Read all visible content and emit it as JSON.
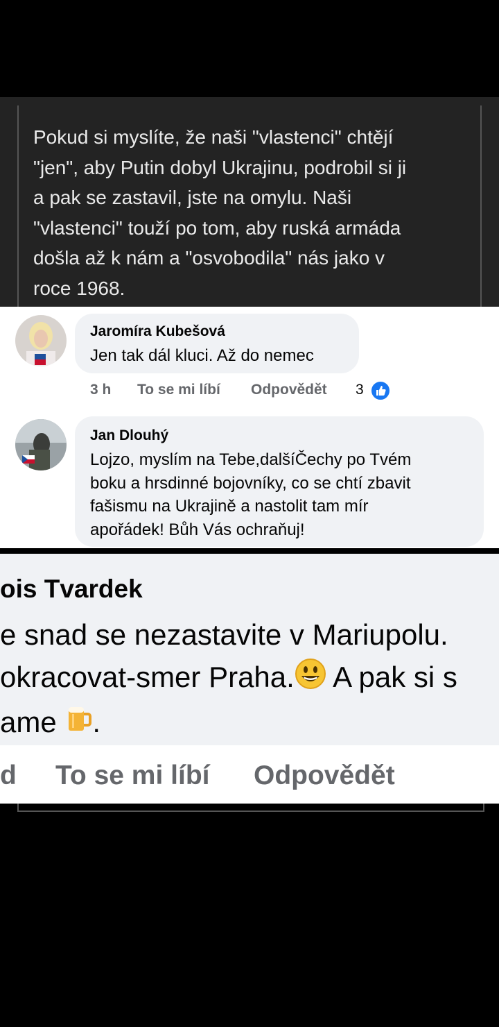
{
  "post": {
    "text": "Pokud si myslíte, že naši \"vlastenci\" chtějí\n\"jen\", aby Putin dobyl Ukrajinu, podrobil si ji\na pak se zastavil, jste na omylu. Naši\n\"vlastenci\" touží po tom, aby ruská armáda\ndošla až k nám a \"osvobodila\" nás jako v\nroce 1968."
  },
  "comments": [
    {
      "author": "Jaromíra Kubešová",
      "text": "Jen tak dál kluci. Až do nemec",
      "time": "3 h",
      "like_label": "To se mi líbí",
      "reply_label": "Odpovědět",
      "reactions": "3",
      "reaction_icon": "thumbs-up-icon"
    },
    {
      "author": "Jan Dlouhý",
      "text": "Lojzo, myslím na Tebe,dalšíČechy po Tvém\nboku a hrsdinné bojovníky, co se chtí zbavit\nfašismu na Ukrajině a nastolit tam mír\napořádek! Bůh Vás ochraňuj!"
    }
  ],
  "zoomed_comment": {
    "author": "ois Tvardek",
    "line1": "e snad se nezastavite v Mariupolu.",
    "line2": "okracovat-smer Praha.",
    "line2b": " A pak si s",
    "line3": "ame ",
    "line3b": ".",
    "time_fragment": "d",
    "like_label": "To se mi líbí",
    "reply_label": "Odpovědět",
    "emoji_1": "grinning-face-icon",
    "emoji_2": "beer-mug-icon"
  },
  "colors": {
    "dark_card": "#232323",
    "bubble": "#f0f2f5",
    "secondary_text": "#65676b",
    "like_blue": "#1877f2"
  }
}
